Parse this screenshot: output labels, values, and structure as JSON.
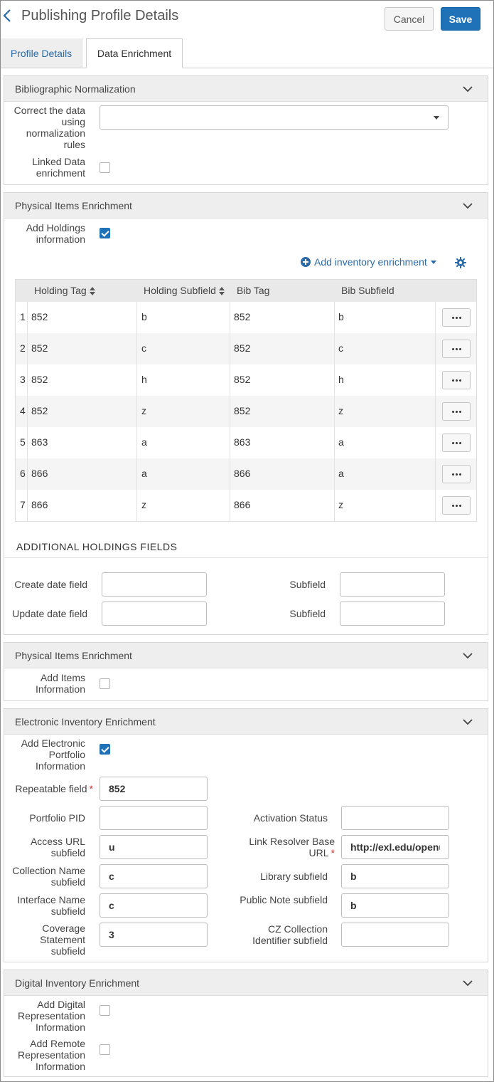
{
  "header": {
    "title": "Publishing Profile Details",
    "cancel_label": "Cancel",
    "save_label": "Save"
  },
  "tabs": [
    {
      "label": "Profile Details",
      "active": false
    },
    {
      "label": "Data Enrichment",
      "active": true
    }
  ],
  "bib_norm": {
    "title": "Bibliographic Normalization",
    "correct_label": "Correct the data using normalization rules",
    "correct_value": "",
    "linked_label": "Linked Data enrichment",
    "linked_checked": false
  },
  "physical_holdings": {
    "title": "Physical Items Enrichment",
    "add_holdings_label": "Add Holdings information",
    "add_holdings_checked": true,
    "add_enrichment_label": "Add inventory enrichment",
    "columns": [
      "Holding Tag",
      "Holding Subfield",
      "Bib Tag",
      "Bib Subfield"
    ],
    "rows": [
      {
        "n": "1",
        "holding_tag": "852",
        "holding_sub": "b",
        "bib_tag": "852",
        "bib_sub": "b"
      },
      {
        "n": "2",
        "holding_tag": "852",
        "holding_sub": "c",
        "bib_tag": "852",
        "bib_sub": "c"
      },
      {
        "n": "3",
        "holding_tag": "852",
        "holding_sub": "h",
        "bib_tag": "852",
        "bib_sub": "h"
      },
      {
        "n": "4",
        "holding_tag": "852",
        "holding_sub": "z",
        "bib_tag": "852",
        "bib_sub": "z"
      },
      {
        "n": "5",
        "holding_tag": "863",
        "holding_sub": "a",
        "bib_tag": "863",
        "bib_sub": "a"
      },
      {
        "n": "6",
        "holding_tag": "866",
        "holding_sub": "a",
        "bib_tag": "866",
        "bib_sub": "a"
      },
      {
        "n": "7",
        "holding_tag": "866",
        "holding_sub": "z",
        "bib_tag": "866",
        "bib_sub": "z"
      }
    ],
    "additional_title": "ADDITIONAL HOLDINGS FIELDS",
    "create_date_label": "Create date field",
    "update_date_label": "Update date field",
    "subfield_label": "Subfield",
    "create_date_value": "",
    "create_sub_value": "",
    "update_date_value": "",
    "update_sub_value": ""
  },
  "physical_items": {
    "title": "Physical Items Enrichment",
    "add_items_label": "Add Items Information",
    "add_items_checked": false
  },
  "electronic": {
    "title": "Electronic Inventory Enrichment",
    "add_portfolio_label": "Add Electronic Portfolio Information",
    "add_portfolio_checked": true,
    "repeatable_label": "Repeatable field",
    "repeatable_value": "852",
    "portfolio_pid_label": "Portfolio PID",
    "portfolio_pid_value": "",
    "activation_label": "Activation Status",
    "activation_value": "",
    "access_url_label": "Access URL subfield",
    "access_url_value": "u",
    "link_resolver_label": "Link Resolver Base URL",
    "link_resolver_value": "http://exl.edu/openurl",
    "collection_label": "Collection Name subfield",
    "collection_value": "c",
    "library_label": "Library subfield",
    "library_value": "b",
    "interface_label": "Interface Name subfield",
    "interface_value": "c",
    "public_note_label": "Public Note subfield",
    "public_note_value": "b",
    "coverage_label": "Coverage Statement subfield",
    "coverage_value": "3",
    "cz_label": "CZ Collection Identifier subfield",
    "cz_value": ""
  },
  "digital": {
    "title": "Digital Inventory Enrichment",
    "add_digital_label": "Add Digital Representation Information",
    "add_digital_checked": false,
    "add_remote_label": "Add Remote Representation Information",
    "add_remote_checked": false
  },
  "icons": {
    "back": "chevron-left-icon",
    "collapse": "chevron-down-icon",
    "add": "plus-circle-icon",
    "settings": "gear-icon",
    "more": "ellipsis-icon",
    "sort": "sort-icon",
    "dropdown": "caret-down-icon"
  },
  "colors": {
    "primary": "#1f72b8",
    "link": "#2b6aa6",
    "section_header": "#eeeeee",
    "required": "#d9302c"
  }
}
